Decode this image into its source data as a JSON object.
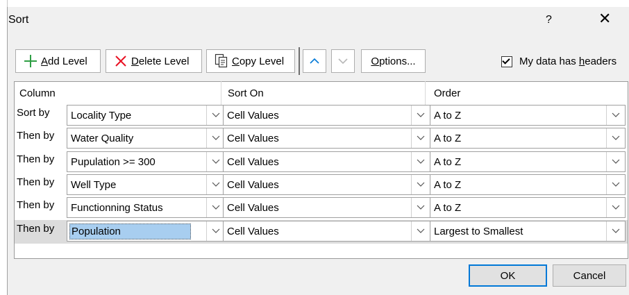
{
  "window": {
    "title": "Sort",
    "help": "?",
    "close": "✕"
  },
  "toolbar": {
    "add_level": {
      "mnemonic": "A",
      "rest": "dd Level"
    },
    "delete_level": {
      "mnemonic": "D",
      "rest": "elete Level"
    },
    "copy_level": {
      "mnemonic": "C",
      "rest": "opy Level"
    },
    "options": {
      "mnemonic": "O",
      "rest": "ptions..."
    },
    "headers_checkbox": {
      "prefix": "My data has ",
      "mnemonic": "h",
      "rest": "eaders",
      "checked": true
    }
  },
  "columns": {
    "column": "Column",
    "sort_on": "Sort On",
    "order": "Order"
  },
  "rows": [
    {
      "label": "Sort by",
      "column": "Locality Type",
      "sort_on": "Cell Values",
      "order": "A to Z"
    },
    {
      "label": "Then by",
      "column": "Water Quality",
      "sort_on": "Cell Values",
      "order": "A to Z"
    },
    {
      "label": "Then by",
      "column": "Pupulation >= 300",
      "sort_on": "Cell Values",
      "order": "A to Z"
    },
    {
      "label": "Then by",
      "column": "Well Type",
      "sort_on": "Cell Values",
      "order": "A to Z"
    },
    {
      "label": "Then by",
      "column": "Functionning Status",
      "sort_on": "Cell Values",
      "order": "A to Z"
    },
    {
      "label": "Then by",
      "column": "Population",
      "sort_on": "Cell Values",
      "order": "Largest to Smallest"
    }
  ],
  "footer": {
    "ok": "OK",
    "cancel": "Cancel"
  },
  "colors": {
    "accent": "#0078d7",
    "selection": "#a8cef0",
    "add_icon": "#2e9e44",
    "delete_icon": "#e81123"
  }
}
